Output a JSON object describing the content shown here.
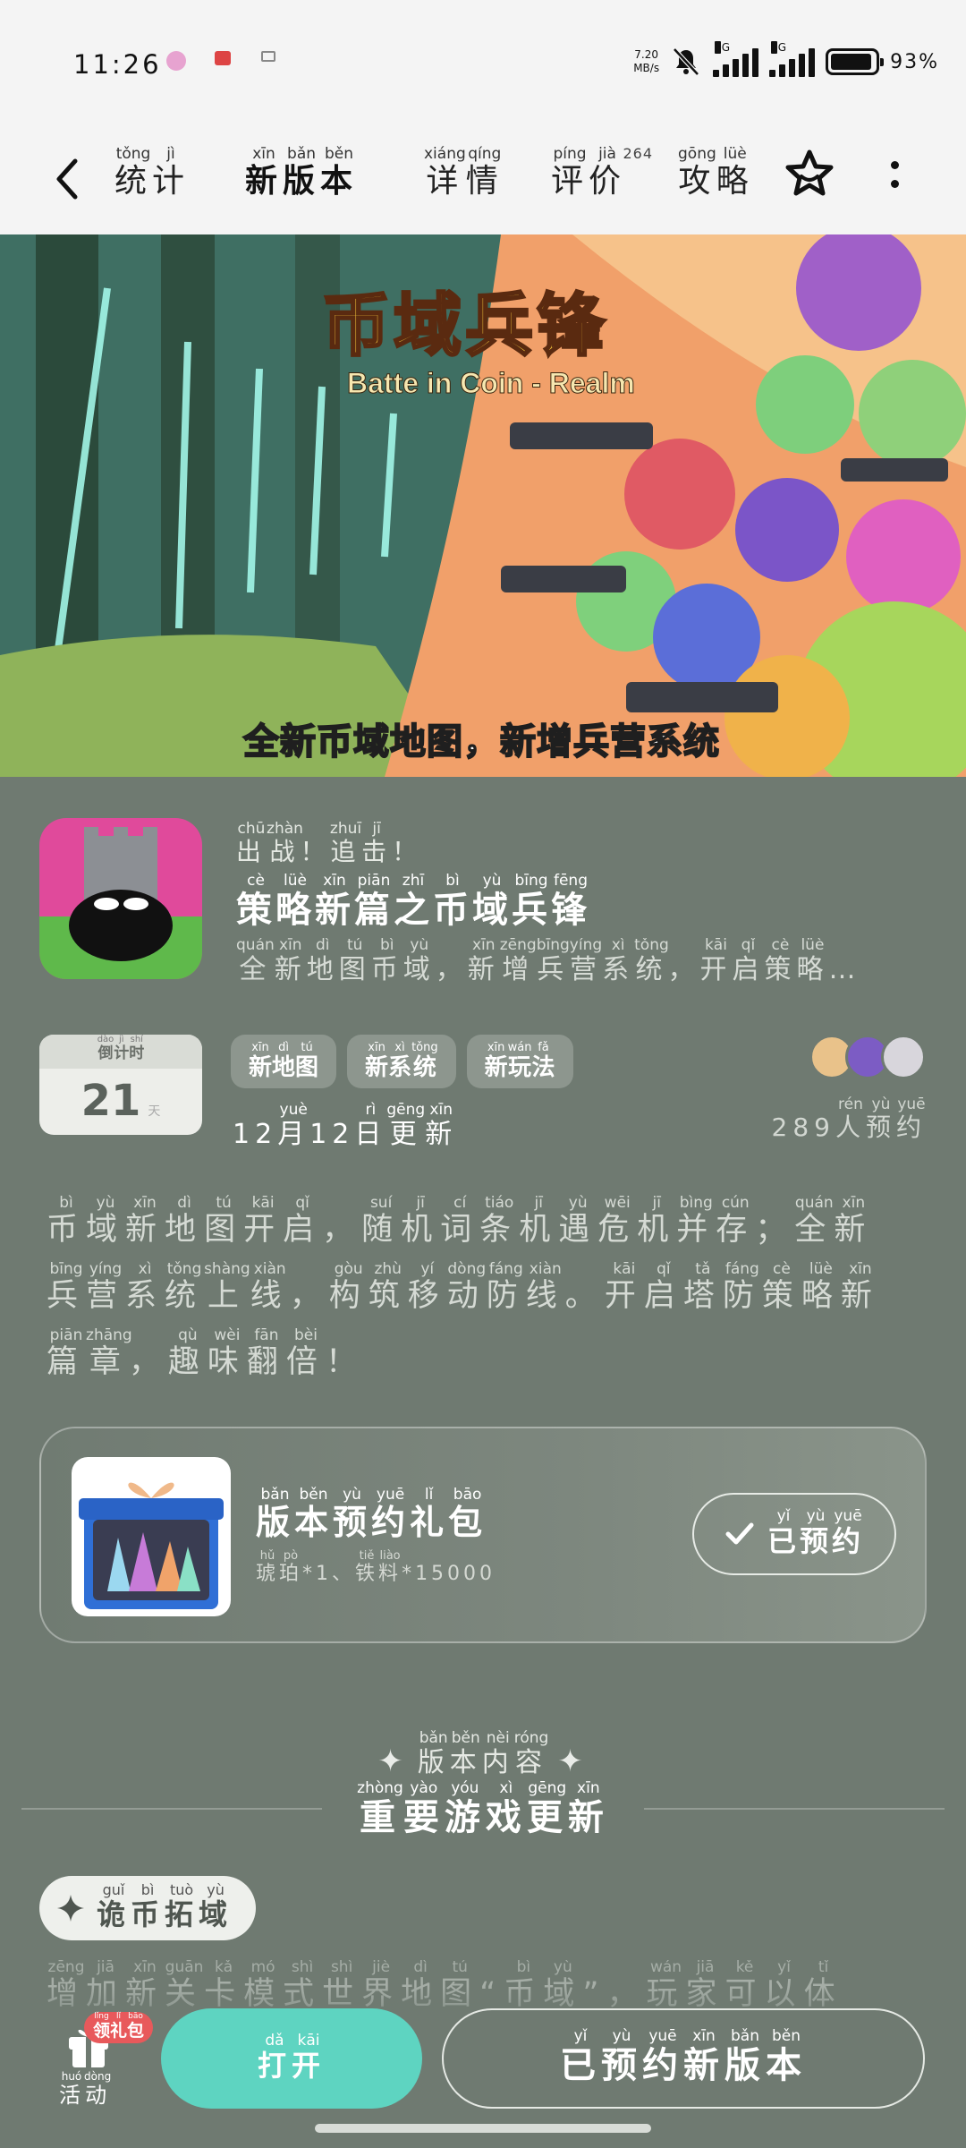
{
  "status_bar": {
    "time": "11:26",
    "net_speed_value": "7.20",
    "net_speed_unit": "MB/s",
    "signal1_label": "5G",
    "signal2_label": "5G",
    "battery_percent": "93%",
    "battery_level": 0.93
  },
  "tabs": {
    "stats": {
      "label": [
        "统",
        "计"
      ],
      "pinyin": [
        "tǒng",
        "jì"
      ]
    },
    "new_version": {
      "label": [
        "新",
        "版",
        "本"
      ],
      "pinyin": [
        "xīn",
        "bǎn",
        "běn"
      ]
    },
    "details": {
      "label": [
        "详",
        "情"
      ],
      "pinyin": [
        "xiáng",
        "qíng"
      ]
    },
    "reviews": {
      "label": [
        "评",
        "价"
      ],
      "pinyin": [
        "píng",
        "jià"
      ],
      "count": "264"
    },
    "guide": {
      "label": [
        "攻",
        "略"
      ],
      "pinyin": [
        "gōng",
        "lüè"
      ]
    }
  },
  "banner": {
    "title": "币域兵锋",
    "subtitle": "Batte in Coin - Realm",
    "caption": "全新币域地图，新增兵营系统"
  },
  "game": {
    "tagline": {
      "label": [
        "出",
        "战",
        "！",
        "追",
        "击",
        "！"
      ],
      "pinyin": [
        "chū",
        "zhàn",
        "",
        "zhuī",
        "jī",
        ""
      ]
    },
    "name": {
      "label": [
        "策",
        "略",
        "新",
        "篇",
        "之",
        "币",
        "域",
        "兵",
        "锋"
      ],
      "pinyin": [
        "cè",
        "lüè",
        "xīn",
        "piān",
        "zhī",
        "bì",
        "yù",
        "bīng",
        "fēng"
      ]
    },
    "description": {
      "label": [
        "全",
        "新",
        "地",
        "图",
        "币",
        "域",
        "，",
        "新",
        "增",
        "兵",
        "营",
        "系",
        "统",
        "，",
        "开",
        "启",
        "策",
        "略",
        "…"
      ],
      "pinyin": [
        "quán",
        "xīn",
        "dì",
        "tú",
        "bì",
        "yù",
        "",
        "xīn",
        "zēng",
        "bīng",
        "yíng",
        "xì",
        "tǒng",
        "",
        "kāi",
        "qǐ",
        "cè",
        "lüè",
        ""
      ]
    }
  },
  "countdown": {
    "label": {
      "label": [
        "倒",
        "计",
        "时"
      ],
      "pinyin": [
        "dào",
        "jì",
        "shí"
      ]
    },
    "days": "21",
    "unit": "天"
  },
  "tags": [
    {
      "label": [
        "新",
        "地",
        "图"
      ],
      "pinyin": [
        "xīn",
        "dì",
        "tú"
      ]
    },
    {
      "label": [
        "新",
        "系",
        "统"
      ],
      "pinyin": [
        "xīn",
        "xì",
        "tǒng"
      ]
    },
    {
      "label": [
        "新",
        "玩",
        "法"
      ],
      "pinyin": [
        "xīn",
        "wán",
        "fǎ"
      ]
    }
  ],
  "update_date": {
    "prefix": "12",
    "month": {
      "label": [
        "月"
      ],
      "pinyin": [
        "yuè"
      ]
    },
    "day_num": "12",
    "day": {
      "label": [
        "日",
        "更",
        "新"
      ],
      "pinyin": [
        "rì",
        "gēng",
        "xīn"
      ]
    }
  },
  "reservations": {
    "count": "289",
    "label": {
      "label": [
        "人",
        "预",
        "约"
      ],
      "pinyin": [
        "rén",
        "yù",
        "yuē"
      ]
    }
  },
  "description_lines": [
    {
      "label": [
        "币",
        "域",
        "新",
        "地",
        "图",
        "开",
        "启",
        "，",
        "随",
        "机",
        "词",
        "条",
        "机",
        "遇",
        "危",
        "机",
        "并",
        "存",
        "；",
        "全",
        "新"
      ],
      "pinyin": [
        "bì",
        "yù",
        "xīn",
        "dì",
        "tú",
        "kāi",
        "qǐ",
        "",
        "suí",
        "jī",
        "cí",
        "tiáo",
        "jī",
        "yù",
        "wēi",
        "jī",
        "bìng",
        "cún",
        "",
        "quán",
        "xīn"
      ]
    },
    {
      "label": [
        "兵",
        "营",
        "系",
        "统",
        "上",
        "线",
        "，",
        "构",
        "筑",
        "移",
        "动",
        "防",
        "线",
        "。",
        "开",
        "启",
        "塔",
        "防",
        "策",
        "略",
        "新"
      ],
      "pinyin": [
        "bīng",
        "yíng",
        "xì",
        "tǒng",
        "shàng",
        "xiàn",
        "",
        "gòu",
        "zhù",
        "yí",
        "dòng",
        "fáng",
        "xiàn",
        "",
        "kāi",
        "qǐ",
        "tǎ",
        "fáng",
        "cè",
        "lüè",
        "xīn"
      ]
    },
    {
      "label": [
        "篇",
        "章",
        "，",
        "趣",
        "味",
        "翻",
        "倍",
        "！"
      ],
      "pinyin": [
        "piān",
        "zhāng",
        "",
        "qù",
        "wèi",
        "fān",
        "bèi",
        ""
      ]
    }
  ],
  "gift": {
    "title": {
      "label": [
        "版",
        "本",
        "预",
        "约",
        "礼",
        "包"
      ],
      "pinyin": [
        "bǎn",
        "běn",
        "yù",
        "yuē",
        "lǐ",
        "bāo"
      ]
    },
    "items": {
      "label": [
        "琥",
        "珀",
        "*1、",
        "铁",
        "料",
        "*15000"
      ],
      "pinyin": [
        "hǔ",
        "pò",
        "",
        "tiě",
        "liào",
        ""
      ]
    },
    "button": {
      "label": [
        "已",
        "预",
        "约"
      ],
      "pinyin": [
        "yǐ",
        "yù",
        "yuē"
      ]
    }
  },
  "section": {
    "label": {
      "label": [
        "版",
        "本",
        "内",
        "容"
      ],
      "pinyin": [
        "bǎn",
        "běn",
        "nèi",
        "róng"
      ]
    },
    "title": {
      "label": [
        "重",
        "要",
        "游",
        "戏",
        "更",
        "新"
      ],
      "pinyin": [
        "zhòng",
        "yào",
        "yóu",
        "xì",
        "gēng",
        "xīn"
      ]
    }
  },
  "chip": {
    "label": [
      "诡",
      "币",
      "拓",
      "域"
    ],
    "pinyin": [
      "guǐ",
      "bì",
      "tuò",
      "yù"
    ]
  },
  "ghost_text": {
    "label": [
      "增",
      "加",
      "新",
      "关",
      "卡",
      "模",
      "式",
      "世",
      "界",
      "地",
      "图",
      "“",
      "币",
      "域",
      "”",
      "，",
      "玩",
      "家",
      "可",
      "以",
      "体"
    ],
    "pinyin": [
      "zēng",
      "jiā",
      "xīn",
      "guān",
      "kǎ",
      "mó",
      "shì",
      "shì",
      "jiè",
      "dì",
      "tú",
      "",
      "bì",
      "yù",
      "",
      "",
      "wán",
      "jiā",
      "kě",
      "yǐ",
      "tǐ"
    ]
  },
  "bottom": {
    "gift_badge": {
      "label": [
        "领",
        "礼",
        "包"
      ],
      "pinyin": [
        "lǐng",
        "lǐ",
        "bāo"
      ]
    },
    "activity": {
      "label": [
        "活",
        "动"
      ],
      "pinyin": [
        "huó",
        "dòng"
      ]
    },
    "open": {
      "label": [
        "打",
        "开"
      ],
      "pinyin": [
        "dǎ",
        "kāi"
      ]
    },
    "reserved_version": {
      "label": [
        "已",
        "预",
        "约",
        "新",
        "版",
        "本"
      ],
      "pinyin": [
        "yǐ",
        "yù",
        "yuē",
        "xīn",
        "bǎn",
        "běn"
      ]
    }
  },
  "colors": {
    "accent": "#5ed4c1",
    "page_background": "#6f7a71",
    "badge_red": "#e8595b"
  },
  "icons": [
    "back-arrow-icon",
    "star-outline-icon",
    "more-vertical-icon",
    "check-icon",
    "sparkle-icon",
    "gift-box-icon",
    "mute-icon"
  ]
}
